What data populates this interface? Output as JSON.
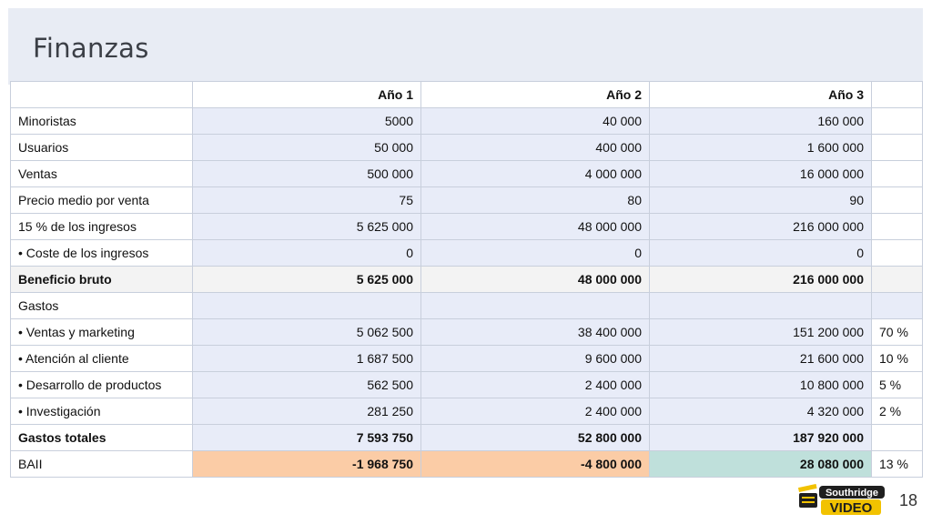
{
  "slide": {
    "title": "Finanzas",
    "page_number": "18"
  },
  "table": {
    "header": [
      "",
      "Año 1",
      "Año 2",
      "Año 3",
      ""
    ],
    "rows": [
      {
        "label": "Minoristas",
        "values": [
          "5000",
          "40 000",
          "160 000"
        ],
        "pct": ""
      },
      {
        "label": "Usuarios",
        "values": [
          "50 000",
          "400 000",
          "1 600 000"
        ],
        "pct": ""
      },
      {
        "label": "Ventas",
        "values": [
          "500 000",
          "4 000 000",
          "16 000 000"
        ],
        "pct": ""
      },
      {
        "label": "Precio medio por venta",
        "values": [
          "75",
          "80",
          "90"
        ],
        "pct": ""
      },
      {
        "label": "15 % de los ingresos",
        "values": [
          "5 625 000",
          "48 000 000",
          "216 000 000"
        ],
        "pct": ""
      },
      {
        "label": "•  Coste de los ingresos",
        "values": [
          "0",
          "0",
          "0"
        ],
        "pct": ""
      },
      {
        "label": "Beneficio bruto",
        "values": [
          "5 625 000",
          "48 000 000",
          "216 000 000"
        ],
        "pct": ""
      },
      {
        "label": "Gastos",
        "values": [
          "",
          "",
          ""
        ],
        "pct": ""
      },
      {
        "label": "•  Ventas y marketing",
        "values": [
          "5 062 500",
          "38 400 000",
          "151 200 000"
        ],
        "pct": "70 %"
      },
      {
        "label": "•  Atención al cliente",
        "values": [
          "1 687 500",
          "9 600 000",
          "21 600 000"
        ],
        "pct": "10 %"
      },
      {
        "label": "•  Desarrollo de productos",
        "values": [
          "562 500",
          "2 400 000",
          "10 800 000"
        ],
        "pct": "5 %"
      },
      {
        "label": "•  Investigación",
        "values": [
          "281 250",
          "2 400 000",
          "4 320 000"
        ],
        "pct": "2 %"
      },
      {
        "label": "Gastos totales",
        "values": [
          "7 593 750",
          "52 800 000",
          "187 920 000"
        ],
        "pct": ""
      },
      {
        "label": "BAII",
        "values": [
          "-1 968 750",
          "-4 800 000",
          "28 080 000"
        ],
        "pct": "13 %"
      }
    ]
  },
  "logo": {
    "top_text": "Southridge",
    "bottom_text": "VIDEO",
    "icon": "clapperboard-icon",
    "colors": {
      "dark": "#1f1f1f",
      "accent": "#f2c200"
    }
  },
  "colors": {
    "title_band": "#e8ecf4",
    "cell_fill": "#e8ecf8",
    "negative_fill": "#fbcca6",
    "positive_fill": "#bfe0db",
    "gross_row_fill": "#f3f3f3"
  }
}
